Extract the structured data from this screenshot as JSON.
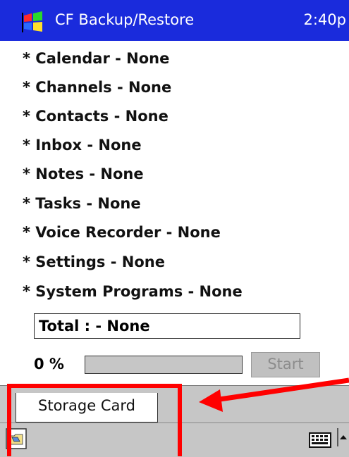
{
  "titlebar": {
    "app_title": "CF Backup/Restore",
    "clock": "2:40p",
    "logo_icon": "windows-flag-icon"
  },
  "items": [
    "* Calendar - None",
    "* Channels - None",
    "* Contacts - None",
    "* Inbox - None",
    "* Notes - None",
    "* Tasks - None",
    "* Voice Recorder - None",
    "* Settings - None",
    "* System Programs - None"
  ],
  "total": {
    "text": "Total :  - None"
  },
  "progress": {
    "percent_label": "0 %",
    "value": 0
  },
  "buttons": {
    "start_label": "Start"
  },
  "tabs": {
    "storage_card_label": "Storage Card"
  },
  "command_bar": {
    "folder_icon": "folder-icon",
    "keyboard_icon": "keyboard-icon",
    "sip_icon": "chevron-up-icon"
  },
  "annotations": {
    "highlight_color": "#ff0000",
    "arrow_color": "#ff0000"
  },
  "colors": {
    "titlebar": "#1a2bdc",
    "chrome": "#c6c6c6"
  }
}
